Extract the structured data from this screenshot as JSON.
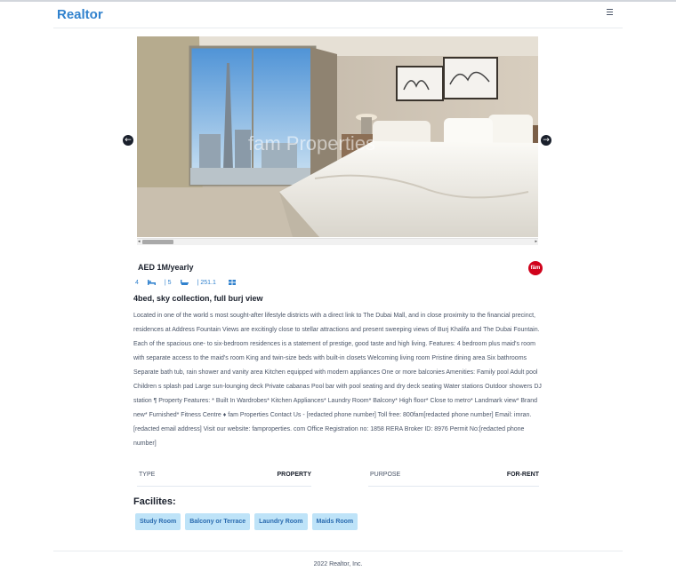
{
  "navbar": {
    "logo": "Realtor",
    "menu_icon": "hamburger-icon"
  },
  "carousel": {
    "prev_icon": "arrow-left-icon",
    "next_icon": "arrow-right-icon",
    "watermark": "fam Properties",
    "scroll_left_glyph": "◂",
    "scroll_right_glyph": "▸"
  },
  "listing": {
    "price": "AED 1M/yearly",
    "agency_logo_text": "fäm",
    "beds": "4",
    "baths": "| 5",
    "area": "| 251.1",
    "bed_icon": "bed-icon",
    "bath_icon": "bath-icon",
    "area_icon": "grid-icon",
    "title": "4bed, sky collection, full burj view",
    "description": "Located in one of the world s most sought-after lifestyle districts with a direct link to The Dubai Mall, and in close proximity to the financial precinct, residences at Address Fountain Views are excitingly close to stellar attractions and present sweeping views of Burj Khalifa and The Dubai Fountain. Each of the spacious one- to six-bedroom residences is a statement of prestige, good taste and high living. Features: 4 bedroom plus maid's room with separate access to the maid's room King and twin-size beds with built-in closets Welcoming living room Pristine dining area Six bathrooms Separate bath tub, rain shower and vanity area Kitchen equipped with modern appliances One or more balconies Amenities: Family pool Adult pool Children s splash pad Large sun-lounging deck Private cabanas Pool bar with pool seating and dry deck seating Water stations Outdoor showers DJ station ¶ Property Features: * Built In Wardrobes* Kitchen Appliances* Laundry Room* Balcony* High floor* Close to metro* Landmark view* Brand new* Furnished* Fitness Centre ♦ fam Properties Contact Us - [redacted phone number] Toll free: 800fam[redacted phone number] Email: imran. [redacted email address] Visit our website: famproperties. com Office Registration no: 1858 RERA Broker ID: 8976 Permit No:[redacted phone number]",
    "type_label": "TYPE",
    "type_value": "PROPERTY",
    "purpose_label": "PURPOSE",
    "purpose_value": "FOR-RENT"
  },
  "facilities": {
    "heading": "Facilites:",
    "items": [
      "Study Room",
      "Balcony or Terrace",
      "Laundry Room",
      "Maids Room"
    ]
  },
  "footer": {
    "text": "2022 Realtor, Inc."
  },
  "colors": {
    "brand": "#3182ce",
    "tag_bg": "#bee3f8",
    "tag_text": "#2b6cb0",
    "agency": "#d0021b"
  }
}
